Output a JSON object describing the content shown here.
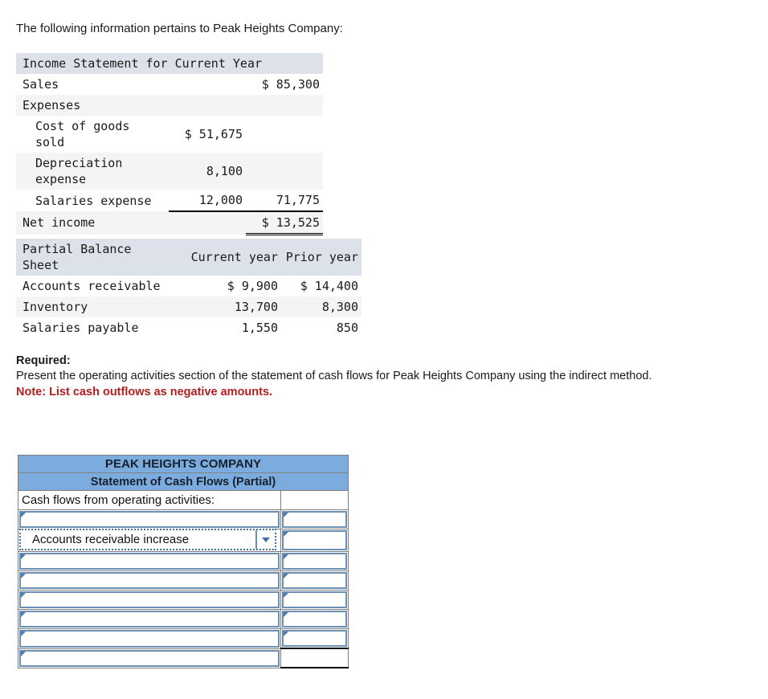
{
  "intro": {
    "text": "The following information pertains to Peak Heights Company:"
  },
  "income_statement": {
    "title": "Income Statement for Current Year",
    "rows": [
      {
        "label": "Sales",
        "indent": false,
        "amount1": "",
        "amount2": "$ 85,300"
      },
      {
        "label": "Expenses",
        "indent": false,
        "amount1": "",
        "amount2": ""
      },
      {
        "label": "Cost of goods sold",
        "indent": true,
        "amount1": "$ 51,675",
        "amount2": ""
      },
      {
        "label": "Depreciation expense",
        "indent": true,
        "amount1": "8,100",
        "amount2": ""
      },
      {
        "label": "Salaries expense",
        "indent": true,
        "amount1": "12,000",
        "amount2": "71,775"
      },
      {
        "label": "Net income",
        "indent": false,
        "amount1": "",
        "amount2": "$ 13,525"
      }
    ]
  },
  "balance_sheet": {
    "title": "Partial Balance Sheet",
    "col_current": "Current year",
    "col_prior": "Prior year",
    "rows": [
      {
        "label": "Accounts receivable",
        "current": "$ 9,900",
        "prior": "$ 14,400"
      },
      {
        "label": "Inventory",
        "current": "13,700",
        "prior": "8,300"
      },
      {
        "label": "Salaries payable",
        "current": "1,550",
        "prior": "850"
      }
    ]
  },
  "required": {
    "label": "Required:",
    "body": "Present the operating activities section of the statement of cash flows for Peak Heights Company using the indirect method.",
    "note": "Note: List cash outflows as negative amounts."
  },
  "answer_sheet": {
    "company_title": "PEAK HEIGHTS COMPANY",
    "statement_title": "Statement of Cash Flows (Partial)",
    "lead_label": "Cash flows from operating activities:",
    "lead_value": "",
    "selected_option": "Accounts receivable increase",
    "dropdown_icon": "chevron-down-icon",
    "entry_rows": [
      {
        "description": "",
        "amount": ""
      },
      {
        "description": "",
        "amount": ""
      },
      {
        "description": "",
        "amount": ""
      },
      {
        "description": "",
        "amount": ""
      },
      {
        "description": "",
        "amount": ""
      },
      {
        "description": "",
        "amount": ""
      }
    ],
    "total_row": {
      "description": "",
      "amount": ""
    }
  },
  "colors": {
    "header_band": "#dde2ea",
    "row_shade": "#f4f4f4",
    "worksheet_header": "#7cacde",
    "note_red": "#b02020",
    "input_border": "#6c8fb5"
  }
}
